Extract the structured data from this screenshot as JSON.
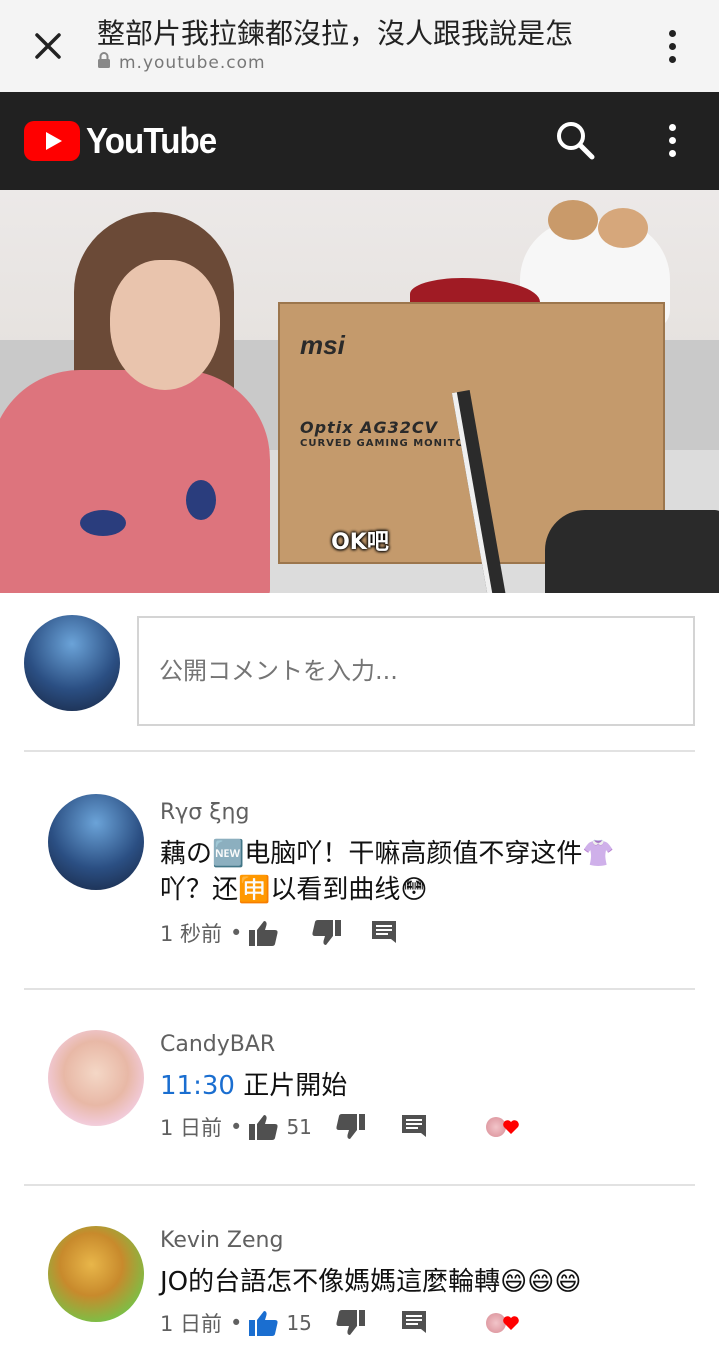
{
  "browser": {
    "title": "整部片我拉鍊都沒拉，沒人跟我說是怎",
    "url": "m.youtube.com"
  },
  "youtube": {
    "logo_text": "YouTube",
    "accent_color": "#ff0000"
  },
  "video": {
    "subtitle": "OK吧",
    "box_brand": "msi",
    "box_model": "Optix AG32CV",
    "box_subtitle": "CURVED GAMING MONITOR"
  },
  "comment_box": {
    "placeholder": "公開コメントを入力..."
  },
  "comments": [
    {
      "author": "Rγσ ξηg",
      "text": "藕の🆕电脑吖！干嘛高颜值不穿这件👚吖？还🈸以看到曲线😳",
      "time": "1 秒前",
      "likes": ""
    },
    {
      "author": "CandyBAR",
      "timestamp_link": "11:30",
      "text": " 正片開始",
      "time": "1 日前",
      "likes": "51"
    },
    {
      "author": "Kevin Zeng",
      "text": "JO的台語怎不像媽媽這麼輪轉😄😄😄",
      "time": "1 日前",
      "likes": "15"
    }
  ],
  "icons": {
    "close": "close-icon",
    "lock": "lock-icon",
    "more": "more-vert-icon",
    "search": "search-icon",
    "like": "thumb-up-icon",
    "dislike": "thumb-down-icon",
    "reply": "comment-icon",
    "heart": "creator-heart-icon"
  }
}
